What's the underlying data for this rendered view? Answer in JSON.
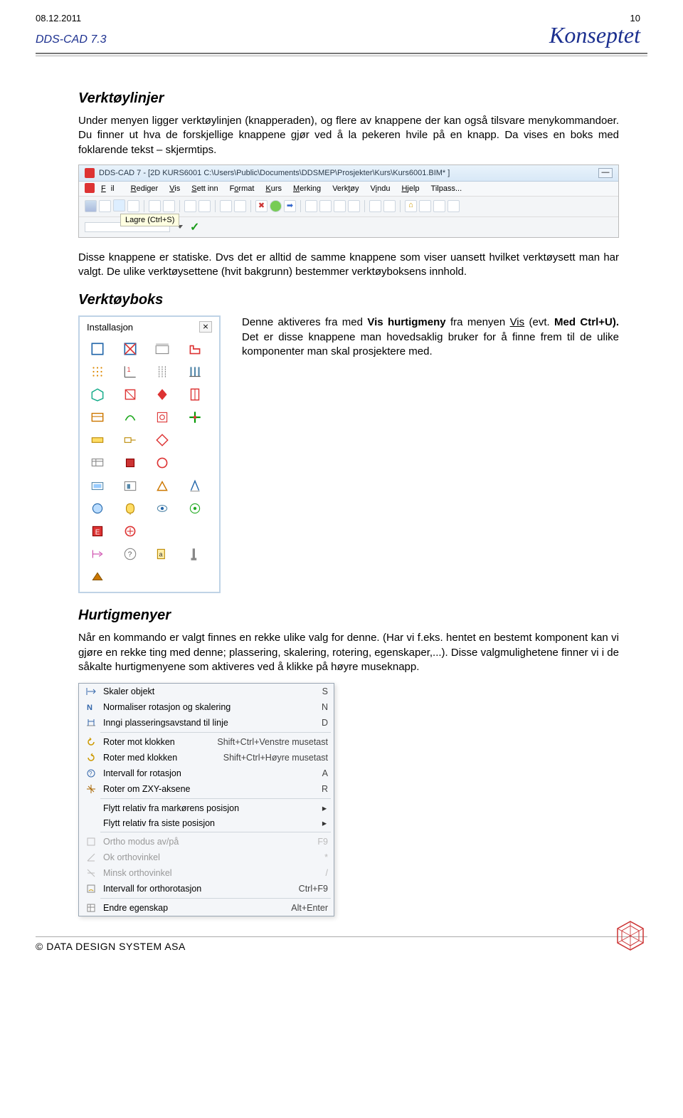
{
  "header": {
    "date": "08.12.2011",
    "pagenum": "10",
    "brand_left": "DDS-CAD 7.3",
    "brand_right": "Konseptet"
  },
  "sections": {
    "verktoylinjer_title": "Verktøylinjer",
    "verktoylinjer_p1": "Under menyen ligger verktøylinjen (knapperaden), og flere av knappene der kan også tilsvare menykommandoer. Du finner ut hva de forskjellige knappene gjør ved å la pekeren hvile på en knapp. Da vises en boks med foklarende tekst – skjermtips.",
    "verktoylinjer_p2": "Disse knappene er statiske. Dvs det er alltid de samme knappene som viser uansett hvilket verktøysett man har valgt. De ulike verktøysettene (hvit bakgrunn) bestemmer verktøyboksens innhold.",
    "verktoyboks_title": "Verktøyboks",
    "verktoyboks_p_pre": "Denne aktiveres fra med ",
    "verktoyboks_bold1": "Vis hurtigmeny",
    "verktoyboks_p_mid1": " fra menyen ",
    "verktoyboks_underline": "Vis",
    "verktoyboks_p_mid2": " (evt. ",
    "verktoyboks_bold2": "Med Ctrl+U).",
    "verktoyboks_p_post": " Det er disse knappene man hovedsaklig bruker for å finne frem til de ulike komponenter man skal prosjektere med.",
    "hurtigmenyer_title": "Hurtigmenyer",
    "hurtigmenyer_p": "Når en kommando er valgt finnes en rekke ulike valg for denne. (Har vi f.eks. hentet en bestemt komponent kan vi gjøre en rekke ting med denne; plassering, skalering, rotering, egenskaper,...). Disse valgmulighetene finner vi i de såkalte hurtigmenyene som aktiveres ved å klikke på høyre museknapp."
  },
  "toolbar": {
    "title": "DDS-CAD 7 - [2D  KURS6001  C:\\Users\\Public\\Documents\\DDSMEP\\Prosjekter\\Kurs\\Kurs6001.BIM* ]",
    "menu": [
      "Fil",
      "Rediger",
      "Vis",
      "Sett inn",
      "Format",
      "Kurs",
      "Merking",
      "Verktøy",
      "Vindu",
      "Hjelp",
      "Tilpass..."
    ],
    "tooltip": "Lagre (Ctrl+S)"
  },
  "vbpanel": {
    "title": "Installasjon",
    "close": "⨯"
  },
  "ctx": [
    {
      "icon": "scale",
      "label": "Skaler objekt",
      "shortcut": "S",
      "disabled": false
    },
    {
      "icon": "norm",
      "label": "Normaliser rotasjon og skalering",
      "shortcut": "N",
      "disabled": false
    },
    {
      "icon": "dist",
      "label": "Inngi plasseringsavstand til linje",
      "shortcut": "D",
      "disabled": false
    },
    {
      "sep": true
    },
    {
      "icon": "rotccw",
      "label": "Roter mot klokken",
      "shortcut": "Shift+Ctrl+Venstre musetast",
      "disabled": false
    },
    {
      "icon": "rotcw",
      "label": "Roter med klokken",
      "shortcut": "Shift+Ctrl+Høyre musetast",
      "disabled": false
    },
    {
      "icon": "int",
      "label": "Intervall for rotasjon",
      "shortcut": "A",
      "disabled": false
    },
    {
      "icon": "rotzxy",
      "label": "Roter om ZXY-aksene",
      "shortcut": "R",
      "disabled": false
    },
    {
      "sep": true
    },
    {
      "icon": "",
      "label": "Flytt relativ fra markørens posisjon",
      "shortcut": "",
      "arrow": true,
      "disabled": false
    },
    {
      "icon": "",
      "label": "Flytt relativ fra siste posisjon",
      "shortcut": "",
      "arrow": true,
      "disabled": false
    },
    {
      "sep": true
    },
    {
      "icon": "ortho",
      "label": "Ortho modus av/på",
      "shortcut": "F9",
      "disabled": true
    },
    {
      "icon": "okort",
      "label": "Ok orthovinkel",
      "shortcut": "*",
      "disabled": true
    },
    {
      "icon": "minort",
      "label": "Minsk orthovinkel",
      "shortcut": "/",
      "disabled": true
    },
    {
      "icon": "intort",
      "label": "Intervall for orthorotasjon",
      "shortcut": "Ctrl+F9",
      "disabled": false
    },
    {
      "sep": true
    },
    {
      "icon": "prop",
      "label": "Endre egenskap",
      "shortcut": "Alt+Enter",
      "disabled": false
    }
  ],
  "footer": {
    "text": "© DATA DESIGN SYSTEM ASA"
  }
}
